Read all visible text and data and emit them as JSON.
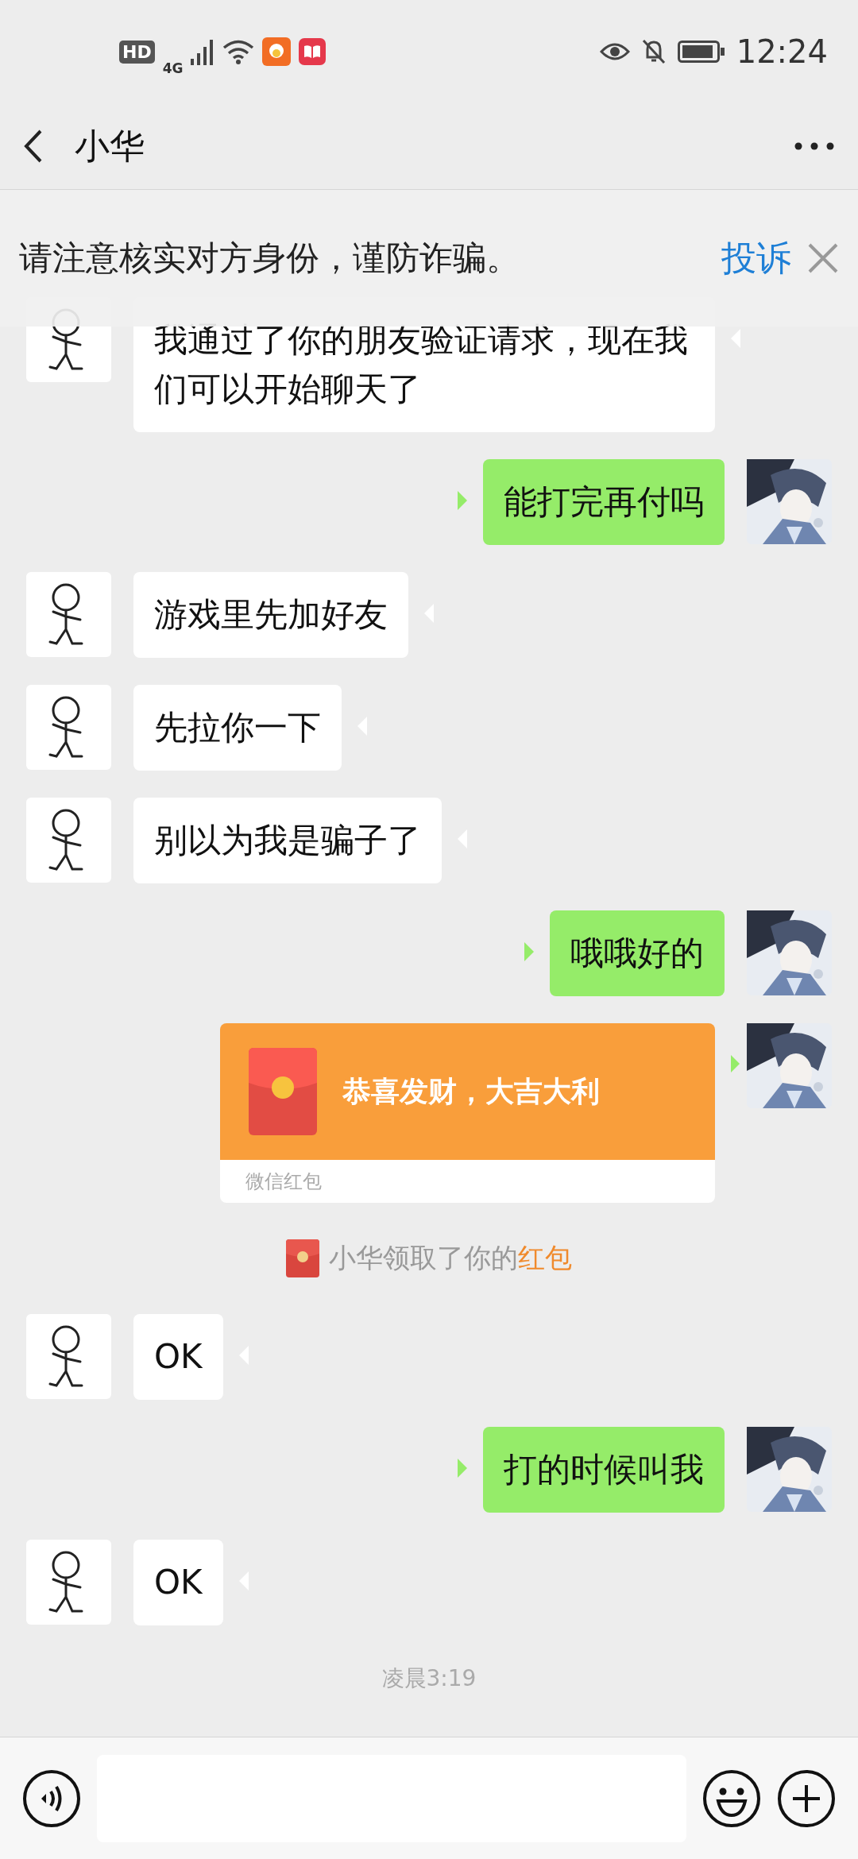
{
  "status_bar": {
    "hd": "HD",
    "network": "4G",
    "time": "12:24"
  },
  "header": {
    "title": "小华"
  },
  "warning_banner": {
    "text": "请注意核实对方身份，谨防诈骗。",
    "action": "投诉"
  },
  "messages": [
    {
      "kind": "received",
      "text": "我通过了你的朋友验证请求，现在我们可以开始聊天了"
    },
    {
      "kind": "sent",
      "text": "能打完再付吗"
    },
    {
      "kind": "received",
      "text": "游戏里先加好友"
    },
    {
      "kind": "received",
      "text": "先拉你一下"
    },
    {
      "kind": "received",
      "text": "别以为我是骗子了"
    },
    {
      "kind": "sent",
      "text": "哦哦好的"
    },
    {
      "kind": "sent_packet",
      "title": "恭喜发财，大吉大利",
      "footer": "微信红包"
    },
    {
      "kind": "system",
      "text": "小华领取了你的",
      "highlight": "红包"
    },
    {
      "kind": "received",
      "text": "OK"
    },
    {
      "kind": "sent",
      "text": "打的时候叫我"
    },
    {
      "kind": "received",
      "text": "OK"
    },
    {
      "kind": "time",
      "text": "凌晨3:19"
    }
  ]
}
